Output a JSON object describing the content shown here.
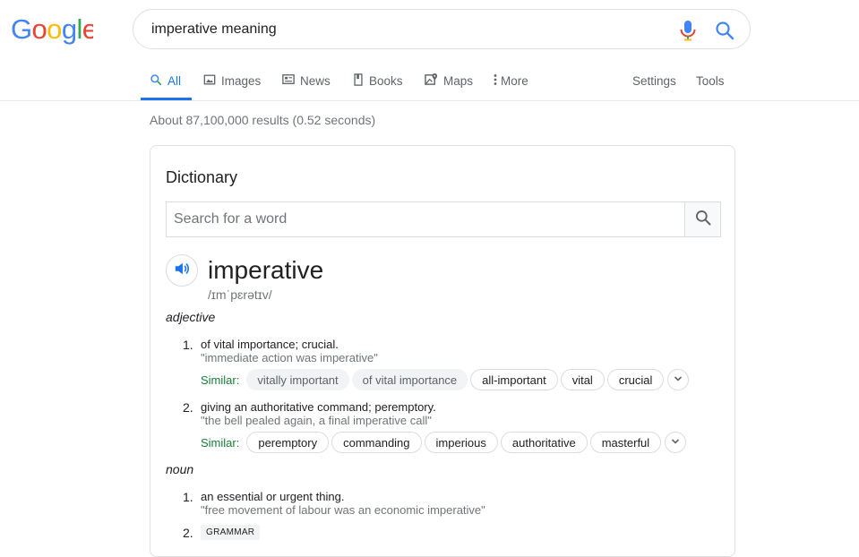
{
  "search": {
    "query": "imperative meaning"
  },
  "logo": {
    "text": "Google",
    "letters": [
      "G",
      "o",
      "o",
      "g",
      "l",
      "e"
    ],
    "colors": [
      "#4285F4",
      "#EA4335",
      "#FBBC05",
      "#4285F4",
      "#34A853",
      "#EA4335"
    ]
  },
  "tabs": [
    {
      "label": "All",
      "icon": "search-icon",
      "active": true
    },
    {
      "label": "Images",
      "icon": "image-icon"
    },
    {
      "label": "News",
      "icon": "news-icon"
    },
    {
      "label": "Books",
      "icon": "book-icon"
    },
    {
      "label": "Maps",
      "icon": "map-icon"
    },
    {
      "label": "More",
      "icon": "more-vertical-icon"
    },
    {
      "label": "Settings"
    },
    {
      "label": "Tools"
    }
  ],
  "result_stats": "About 87,100,000 results (0.52 seconds)",
  "dictionary": {
    "title": "Dictionary",
    "search_placeholder": "Search for a word",
    "word": "imperative",
    "phonetic": "/ɪmˈpɛrətɪv/",
    "entries": [
      {
        "part_of_speech": "adjective",
        "senses": [
          {
            "number": "1.",
            "definition": "of vital importance; crucial.",
            "example": "\"immediate action was imperative\"",
            "similar_label": "Similar:",
            "similar": [
              "vitally important",
              "of vital importance",
              "all-important",
              "vital",
              "crucial"
            ]
          },
          {
            "number": "2.",
            "definition": "giving an authoritative command; peremptory.",
            "example": "\"the bell pealed again, a final imperative call\"",
            "similar_label": "Similar:",
            "similar": [
              "peremptory",
              "commanding",
              "imperious",
              "authoritative",
              "masterful"
            ]
          }
        ]
      },
      {
        "part_of_speech": "noun",
        "senses": [
          {
            "number": "1.",
            "definition": "an essential or urgent thing.",
            "example": "\"free movement of labour was an economic imperative\""
          },
          {
            "number": "2.",
            "label": "GRAMMAR"
          }
        ]
      }
    ]
  },
  "colors": {
    "accent": "#1a73e8",
    "similar_green": "#188038",
    "muted": "#70757a"
  }
}
